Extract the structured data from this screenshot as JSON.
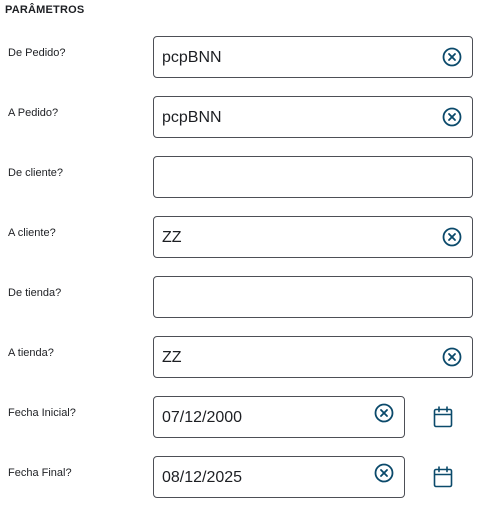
{
  "section": {
    "title": "PARÂMETROS"
  },
  "colors": {
    "accent": "#0b4a6b",
    "border": "#4d4f56",
    "text": "#1d1f23"
  },
  "params": [
    {
      "label": "De Pedido?",
      "value": "pcpBNN",
      "clear_icon": "clear-circle-x-icon"
    },
    {
      "label": "A Pedido?",
      "value": "pcpBNN",
      "clear_icon": "clear-circle-x-icon"
    },
    {
      "label": "De cliente?",
      "value": ""
    },
    {
      "label": "A cliente?",
      "value": "ZZ",
      "clear_icon": "clear-circle-x-icon"
    },
    {
      "label": "De tienda?",
      "value": ""
    },
    {
      "label": "A tienda?",
      "value": "ZZ",
      "clear_icon": "clear-circle-x-icon"
    },
    {
      "label": "Fecha Inicial?",
      "value": "07/12/2000",
      "clear_icon": "clear-circle-x-icon",
      "picker_icon": "calendar-icon"
    },
    {
      "label": "Fecha Final?",
      "value": "08/12/2025",
      "clear_icon": "clear-circle-x-icon",
      "picker_icon": "calendar-icon"
    }
  ]
}
